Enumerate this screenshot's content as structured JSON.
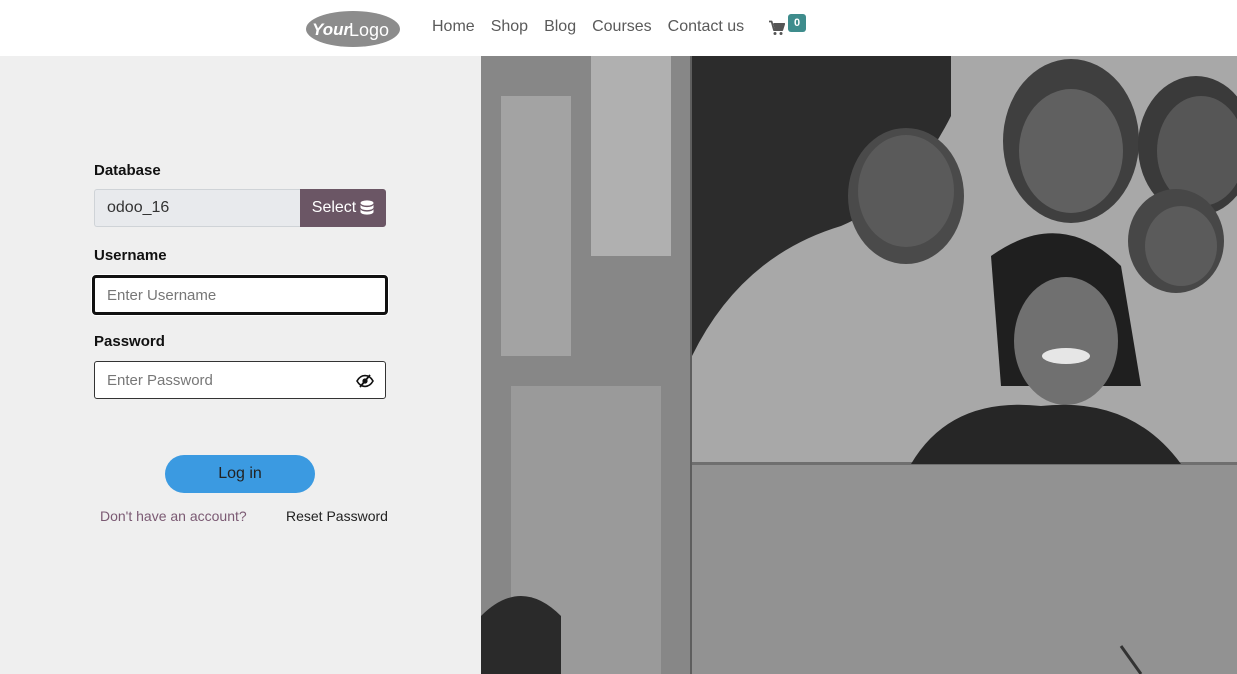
{
  "header": {
    "logo_text_your": "Your",
    "logo_text_logo": "Logo",
    "nav": [
      "Home",
      "Shop",
      "Blog",
      "Courses",
      "Contact us"
    ],
    "cart_count": "0",
    "cart_badge_color": "#3e8c8c"
  },
  "login": {
    "database_label": "Database",
    "database_value": "odoo_16",
    "select_label": "Select",
    "select_icon": "database-icon",
    "username_label": "Username",
    "username_placeholder": "Enter Username",
    "password_label": "Password",
    "password_placeholder": "Enter Password",
    "password_toggle_icon": "eye-slash-icon",
    "login_button": "Log in",
    "signup_link": "Don't have an account?",
    "reset_link": "Reset Password"
  },
  "colors": {
    "select_button": "#6b5665",
    "login_button": "#3b9ae1",
    "panel_background": "#efefef",
    "signup_link": "#7b5a73"
  }
}
